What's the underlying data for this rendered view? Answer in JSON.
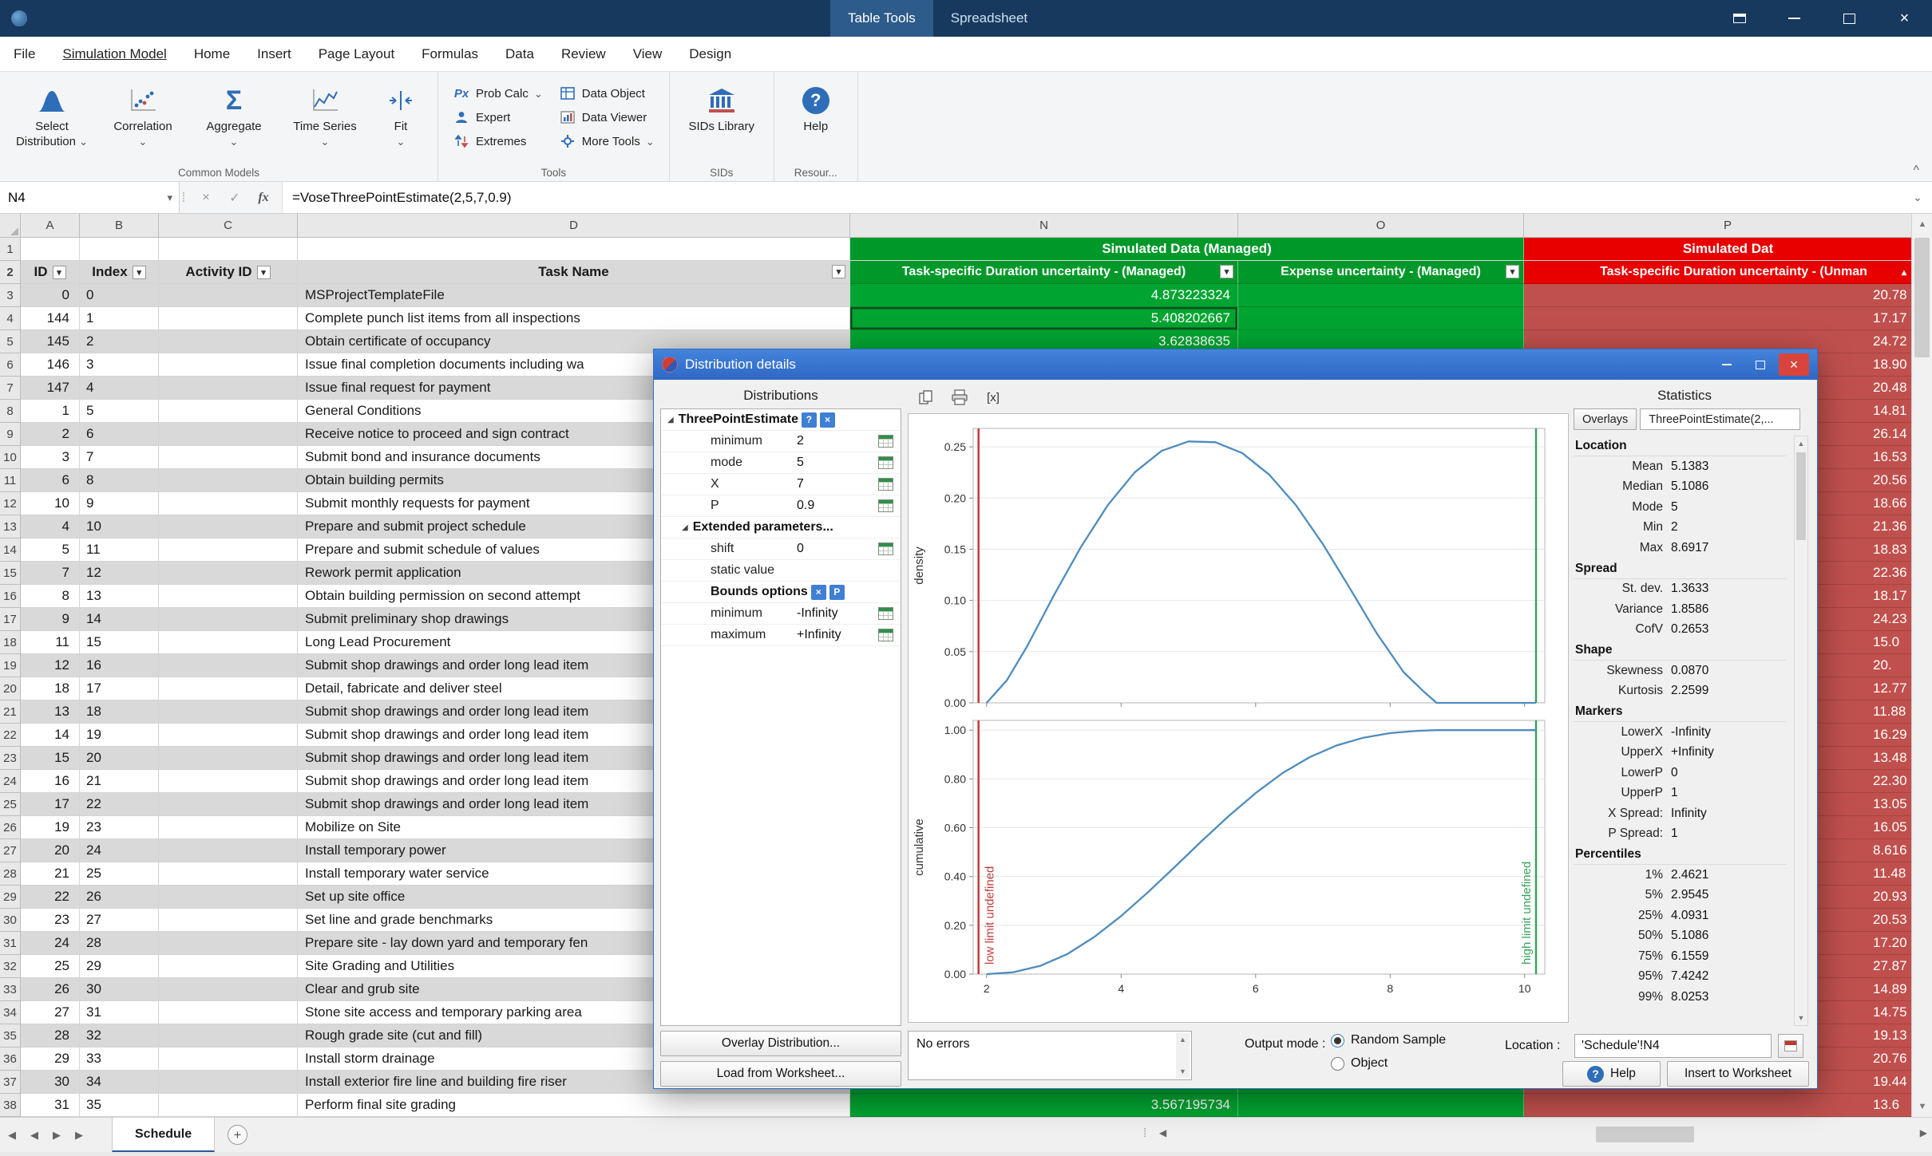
{
  "colors": {
    "titlebar": "#17395e",
    "titlebar_tab": "#2d5b8a",
    "accent": "#2e6db8",
    "green_header": "#009929",
    "green_cell": "#00a431",
    "red_header": "#e80000",
    "red_cell": "#c0504d",
    "dialog_title_1": "#4384dc",
    "dialog_title_2": "#2f67c4",
    "curve": "#4e8cbe",
    "marker_low": "#c23b3b",
    "marker_high": "#3aa35c"
  },
  "icons": {
    "caret_down": "⌄",
    "filter": "▾",
    "sort_up": "▴",
    "close": "×",
    "check": "✓",
    "fx": "fx",
    "dots": "⁞",
    "scroll_up": "▲",
    "scroll_down": "▼",
    "scroll_left": "◀",
    "scroll_right": "▶",
    "nav_first": "◀",
    "nav_prev": "◀",
    "nav_next": "▶",
    "nav_last": "▶",
    "add_sheet": "+",
    "expander": "◢",
    "collapse_ribbon": "^",
    "sigma": "Σ",
    "prob_calc": "Px",
    "bracket_x": "[x]",
    "help_q": "?",
    "tab_dots": "⁞"
  },
  "titlebar": {
    "context_tab": "Table Tools",
    "app_title": "Spreadsheet"
  },
  "menu": {
    "tabs": [
      "File",
      "Simulation Model",
      "Home",
      "Insert",
      "Page Layout",
      "Formulas",
      "Data",
      "Review",
      "View",
      "Design"
    ],
    "active_index": 1
  },
  "ribbon": {
    "groups": [
      "Common Models",
      "Tools",
      "SIDs",
      "Resour..."
    ],
    "select_distribution": "Select Distribution",
    "correlation": "Correlation",
    "aggregate": "Aggregate",
    "time_series": "Time Series",
    "fit": "Fit",
    "prob_calc": "Prob Calc",
    "expert": "Expert",
    "extremes": "Extremes",
    "data_object": "Data Object",
    "data_viewer": "Data Viewer",
    "more_tools": "More Tools",
    "sids_library": "SIDs Library",
    "help": "Help"
  },
  "formula_bar": {
    "name_box": "N4",
    "formula": "=VoseThreePointEstimate(2,5,7,0.9)"
  },
  "grid": {
    "column_headers": [
      "A",
      "B",
      "C",
      "D",
      "N",
      "O",
      "P"
    ],
    "banners": {
      "green": "Simulated Data (Managed)",
      "red": "Simulated Dat"
    },
    "table_headers": {
      "id": "ID",
      "index": "Index",
      "activity_id": "Activity ID",
      "task_name": "Task Name",
      "n": "Task-specific Duration uncertainty - (Managed)",
      "o": "Expense uncertainty - (Managed)",
      "p": "Task-specific Duration uncertainty - (Unman"
    },
    "rows": [
      {
        "r": 3,
        "id": "0",
        "ix": "0",
        "task": "MSProjectTemplateFile",
        "n": "4.873223324",
        "p": "20.78"
      },
      {
        "r": 4,
        "id": "144",
        "ix": "1",
        "task": "Complete punch list items from all inspections",
        "n": "5.408202667",
        "p": "17.17",
        "sel": true
      },
      {
        "r": 5,
        "id": "145",
        "ix": "2",
        "task": "Obtain certificate of occupancy",
        "n": "3.62838635",
        "p": "24.72"
      },
      {
        "r": 6,
        "id": "146",
        "ix": "3",
        "task": "Issue final completion documents including wa",
        "n": "",
        "p": "18.90"
      },
      {
        "r": 7,
        "id": "147",
        "ix": "4",
        "task": "Issue final request for payment",
        "n": "",
        "p": "20.48"
      },
      {
        "r": 8,
        "id": "1",
        "ix": "5",
        "task": "General Conditions",
        "n": "",
        "p": "14.81"
      },
      {
        "r": 9,
        "id": "2",
        "ix": "6",
        "task": "Receive notice to proceed and sign contract",
        "n": "",
        "p": "26.14"
      },
      {
        "r": 10,
        "id": "3",
        "ix": "7",
        "task": "Submit bond and insurance documents",
        "n": "",
        "p": "16.53"
      },
      {
        "r": 11,
        "id": "6",
        "ix": "8",
        "task": "Obtain building permits",
        "n": "",
        "p": "20.56"
      },
      {
        "r": 12,
        "id": "10",
        "ix": "9",
        "task": "Submit monthly requests for payment",
        "n": "",
        "p": "18.66"
      },
      {
        "r": 13,
        "id": "4",
        "ix": "10",
        "task": "Prepare and submit project schedule",
        "n": "",
        "p": "21.36"
      },
      {
        "r": 14,
        "id": "5",
        "ix": "11",
        "task": "Prepare and submit schedule of values",
        "n": "",
        "p": "18.83"
      },
      {
        "r": 15,
        "id": "7",
        "ix": "12",
        "task": "Rework permit application",
        "n": "",
        "p": "22.36"
      },
      {
        "r": 16,
        "id": "8",
        "ix": "13",
        "task": "Obtain building permission on second attempt",
        "n": "",
        "p": "18.17"
      },
      {
        "r": 17,
        "id": "9",
        "ix": "14",
        "task": "Submit preliminary shop drawings",
        "n": "",
        "p": "24.23"
      },
      {
        "r": 18,
        "id": "11",
        "ix": "15",
        "task": "Long Lead Procurement",
        "n": "",
        "p": "15.0"
      },
      {
        "r": 19,
        "id": "12",
        "ix": "16",
        "task": "Submit shop drawings and order long lead item",
        "n": "",
        "p": "20."
      },
      {
        "r": 20,
        "id": "18",
        "ix": "17",
        "task": "Detail, fabricate and deliver steel",
        "n": "",
        "p": "12.77"
      },
      {
        "r": 21,
        "id": "13",
        "ix": "18",
        "task": "Submit shop drawings and order long lead item",
        "n": "",
        "p": "11.88"
      },
      {
        "r": 22,
        "id": "14",
        "ix": "19",
        "task": "Submit shop drawings and order long lead item",
        "n": "",
        "p": "16.29"
      },
      {
        "r": 23,
        "id": "15",
        "ix": "20",
        "task": "Submit shop drawings and order long lead item",
        "n": "",
        "p": "13.48"
      },
      {
        "r": 24,
        "id": "16",
        "ix": "21",
        "task": "Submit shop drawings and order long lead item",
        "n": "",
        "p": "22.30"
      },
      {
        "r": 25,
        "id": "17",
        "ix": "22",
        "task": "Submit shop drawings and order long lead item",
        "n": "",
        "p": "13.05"
      },
      {
        "r": 26,
        "id": "19",
        "ix": "23",
        "task": "Mobilize on Site",
        "n": "",
        "p": "16.05"
      },
      {
        "r": 27,
        "id": "20",
        "ix": "24",
        "task": "Install temporary power",
        "n": "",
        "p": "8.616"
      },
      {
        "r": 28,
        "id": "21",
        "ix": "25",
        "task": "Install temporary water service",
        "n": "",
        "p": "11.48"
      },
      {
        "r": 29,
        "id": "22",
        "ix": "26",
        "task": "Set up site office",
        "n": "",
        "p": "20.93"
      },
      {
        "r": 30,
        "id": "23",
        "ix": "27",
        "task": "Set line and grade benchmarks",
        "n": "",
        "p": "20.53"
      },
      {
        "r": 31,
        "id": "24",
        "ix": "28",
        "task": "Prepare site - lay down yard and temporary fen",
        "n": "",
        "p": "17.20"
      },
      {
        "r": 32,
        "id": "25",
        "ix": "29",
        "task": "Site Grading and Utilities",
        "n": "",
        "p": "27.87"
      },
      {
        "r": 33,
        "id": "26",
        "ix": "30",
        "task": "Clear and grub site",
        "n": "",
        "p": "14.89"
      },
      {
        "r": 34,
        "id": "27",
        "ix": "31",
        "task": "Stone site access and temporary parking area",
        "n": "",
        "p": "14.75"
      },
      {
        "r": 35,
        "id": "28",
        "ix": "32",
        "task": "Rough grade site (cut and fill)",
        "n": "",
        "p": "19.13"
      },
      {
        "r": 36,
        "id": "29",
        "ix": "33",
        "task": "Install storm drainage",
        "n": "",
        "p": "20.76"
      },
      {
        "r": 37,
        "id": "30",
        "ix": "34",
        "task": "Install exterior fire line and building fire riser",
        "n": "",
        "p": "19.44"
      },
      {
        "r": 38,
        "id": "31",
        "ix": "35",
        "task": "Perform final site grading",
        "n": "3.567195734",
        "p": "13.6"
      }
    ]
  },
  "dialog": {
    "title": "Distribution details",
    "left": {
      "header": "Distributions",
      "tree": [
        {
          "t": "head",
          "label": "ThreePointEstimate",
          "btns": [
            "?",
            "×"
          ]
        },
        {
          "t": "p",
          "label": "minimum",
          "value": "2",
          "icon": true
        },
        {
          "t": "p",
          "label": "mode",
          "value": "5",
          "icon": true
        },
        {
          "t": "p",
          "label": "X",
          "value": "7",
          "icon": true
        },
        {
          "t": "p",
          "label": "P",
          "value": "0.9",
          "icon": true
        },
        {
          "t": "head",
          "label": "Extended parameters...",
          "ind": 1
        },
        {
          "t": "p",
          "label": "shift",
          "value": "0",
          "icon": true
        },
        {
          "t": "p",
          "label": "static value",
          "value": "",
          "icon": false
        },
        {
          "t": "sub",
          "label": "Bounds options",
          "btns": [
            "×",
            "P"
          ]
        },
        {
          "t": "p",
          "label": "minimum",
          "value": "-Infinity",
          "icon": true
        },
        {
          "t": "p",
          "label": "maximum",
          "value": "+Infinity",
          "icon": true
        }
      ],
      "buttons": [
        "Overlay Distribution...",
        "Load from Worksheet..."
      ]
    },
    "stats": {
      "header": "Statistics",
      "overlays_button": "Overlays",
      "selected_overlay": "ThreePointEstimate(2,...",
      "sections": [
        {
          "header": "Location",
          "rows": [
            [
              "Mean",
              "5.1383"
            ],
            [
              "Median",
              "5.1086"
            ],
            [
              "Mode",
              "5"
            ],
            [
              "Min",
              "2"
            ],
            [
              "Max",
              "8.6917"
            ]
          ]
        },
        {
          "header": "Spread",
          "rows": [
            [
              "St. dev.",
              "1.3633"
            ],
            [
              "Variance",
              "1.8586"
            ],
            [
              "CofV",
              "0.2653"
            ]
          ]
        },
        {
          "header": "Shape",
          "rows": [
            [
              "Skewness",
              "0.0870"
            ],
            [
              "Kurtosis",
              "2.2599"
            ]
          ]
        },
        {
          "header": "Markers",
          "rows": [
            [
              "LowerX",
              "-Infinity"
            ],
            [
              "UpperX",
              "+Infinity"
            ],
            [
              "LowerP",
              "0"
            ],
            [
              "UpperP",
              "1"
            ],
            [
              "X Spread:",
              "Infinity"
            ],
            [
              "P Spread:",
              "1"
            ]
          ]
        },
        {
          "header": "Percentiles",
          "rows": [
            [
              "1%",
              "2.4621"
            ],
            [
              "5%",
              "2.9545"
            ],
            [
              "25%",
              "4.0931"
            ],
            [
              "50%",
              "5.1086"
            ],
            [
              "75%",
              "6.1559"
            ],
            [
              "95%",
              "7.4242"
            ],
            [
              "99%",
              "8.0253"
            ]
          ]
        }
      ]
    },
    "footer": {
      "errors": "No errors",
      "output_mode_label": "Output mode :",
      "radio_random": "Random Sample",
      "radio_object": "Object",
      "location_label": "Location :",
      "location_value": "'Schedule'!N4",
      "help": "Help",
      "insert": "Insert to Worksheet"
    }
  },
  "chart_data": [
    {
      "type": "line",
      "name": "density",
      "title": "",
      "xlabel": "",
      "ylabel": "density",
      "xlim": [
        1.8,
        10.3
      ],
      "ylim": [
        0,
        0.268
      ],
      "yticks": [
        0,
        0.05,
        0.1,
        0.15,
        0.2,
        0.25
      ],
      "ytick_labels": [
        "0.00",
        "0.05",
        "0.10",
        "0.15",
        "0.20",
        "0.25"
      ],
      "xticks": [
        2,
        4,
        6,
        8,
        10
      ],
      "xtick_labels": null,
      "grid": true,
      "series": [
        {
          "name": "density",
          "x": [
            2,
            2.3,
            2.6,
            3,
            3.4,
            3.8,
            4.2,
            4.6,
            5,
            5.4,
            5.8,
            6.2,
            6.6,
            7,
            7.4,
            7.8,
            8.2,
            8.5,
            8.69,
            10.17
          ],
          "y": [
            0,
            0.022,
            0.055,
            0.105,
            0.152,
            0.193,
            0.225,
            0.246,
            0.2553,
            0.2545,
            0.244,
            0.223,
            0.193,
            0.155,
            0.112,
            0.068,
            0.03,
            0.011,
            0,
            0
          ]
        }
      ],
      "markers": [
        {
          "name": "low-limit-line",
          "x": 1.88,
          "color": "#c23b3b",
          "label": ""
        },
        {
          "name": "high-limit-line",
          "x": 10.17,
          "color": "#3aa35c",
          "label": ""
        }
      ]
    },
    {
      "type": "line",
      "name": "cumulative",
      "title": "",
      "xlabel": "",
      "ylabel": "cumulative",
      "xlim": [
        1.8,
        10.3
      ],
      "ylim": [
        0,
        1.04
      ],
      "yticks": [
        0,
        0.2,
        0.4,
        0.6,
        0.8,
        1.0
      ],
      "ytick_labels": [
        "0.00",
        "0.20",
        "0.40",
        "0.60",
        "0.80",
        "1.00"
      ],
      "xticks": [
        2,
        4,
        6,
        8,
        10
      ],
      "xtick_labels": [
        "2",
        "4",
        "6",
        "8",
        "10"
      ],
      "grid": true,
      "series": [
        {
          "name": "cumulative",
          "x": [
            2,
            2.4,
            2.8,
            3.2,
            3.6,
            4,
            4.4,
            4.8,
            5.2,
            5.6,
            6,
            6.4,
            6.8,
            7.2,
            7.6,
            8,
            8.4,
            8.69,
            10.17
          ],
          "y": [
            0,
            0.008,
            0.034,
            0.082,
            0.152,
            0.238,
            0.336,
            0.44,
            0.546,
            0.648,
            0.742,
            0.824,
            0.889,
            0.937,
            0.969,
            0.988,
            0.997,
            1,
            1
          ]
        }
      ],
      "markers": [
        {
          "name": "low-limit-line",
          "x": 1.88,
          "color": "#c23b3b",
          "label": "low limit undefined"
        },
        {
          "name": "high-limit-line",
          "x": 10.17,
          "color": "#3aa35c",
          "label": "high limit undefined"
        }
      ]
    }
  ],
  "sheet_bar": {
    "tab": "Schedule"
  }
}
